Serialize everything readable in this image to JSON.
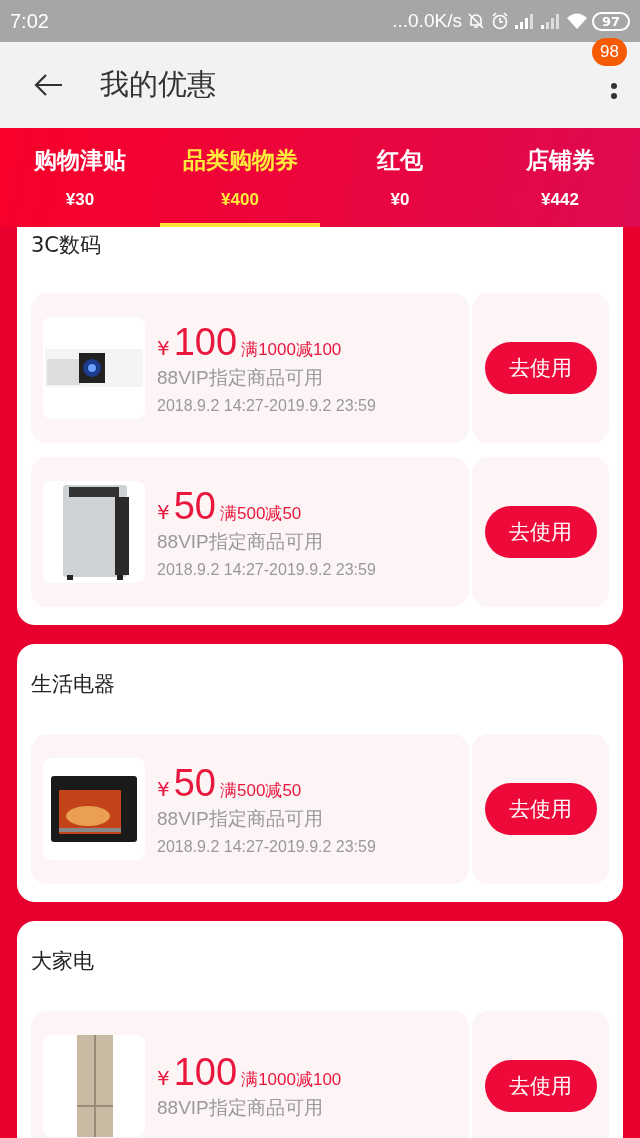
{
  "status_bar": {
    "time": "7:02",
    "speed": "...0.0K/s",
    "battery": "97"
  },
  "header": {
    "title": "我的优惠",
    "badge": "98"
  },
  "tabs": [
    {
      "label": "购物津贴",
      "value": "¥30",
      "selected": false
    },
    {
      "label": "品类购物券",
      "value": "¥400",
      "selected": true
    },
    {
      "label": "红包",
      "value": "¥0",
      "selected": false
    },
    {
      "label": "店铺券",
      "value": "¥442",
      "selected": false
    }
  ],
  "sections": [
    {
      "title": "3C数码",
      "coupons": [
        {
          "currency": "¥",
          "amount": "100",
          "condition": "满1000减100",
          "scope": "88VIP指定商品可用",
          "validity": "2018.9.2 14:27-2019.9.2 23:59",
          "button": "去使用"
        },
        {
          "currency": "¥",
          "amount": "50",
          "condition": "满500减50",
          "scope": "88VIP指定商品可用",
          "validity": "2018.9.2 14:27-2019.9.2 23:59",
          "button": "去使用"
        }
      ]
    },
    {
      "title": "生活电器",
      "coupons": [
        {
          "currency": "¥",
          "amount": "50",
          "condition": "满500减50",
          "scope": "88VIP指定商品可用",
          "validity": "2018.9.2 14:27-2019.9.2 23:59",
          "button": "去使用"
        }
      ]
    },
    {
      "title": "大家电",
      "coupons": [
        {
          "currency": "¥",
          "amount": "100",
          "condition": "满1000减100",
          "scope": "88VIP指定商品可用",
          "button": "去使用"
        }
      ]
    }
  ]
}
